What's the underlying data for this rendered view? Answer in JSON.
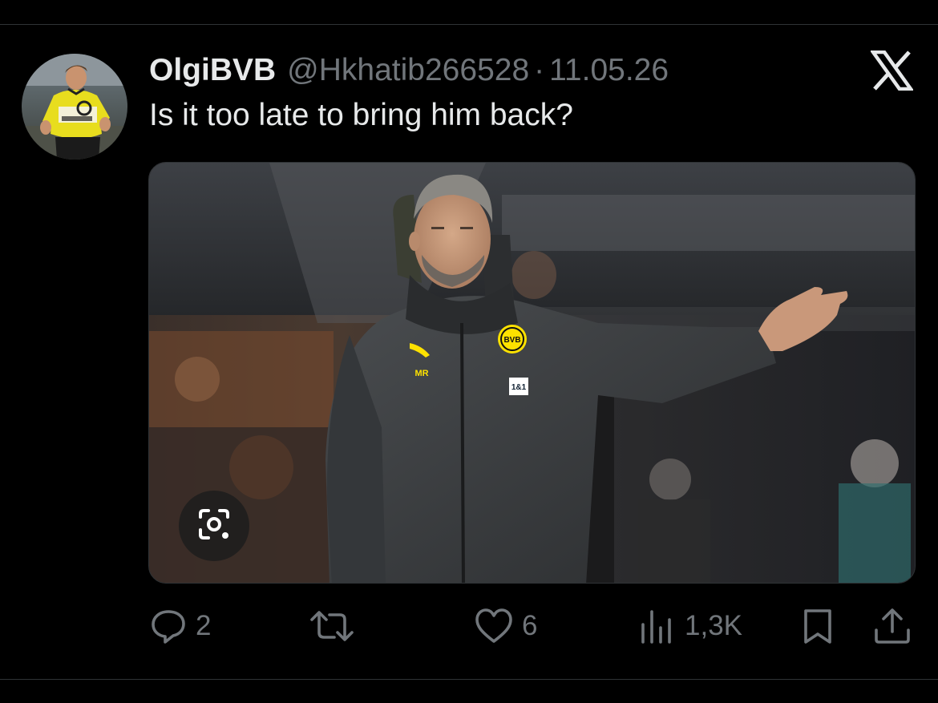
{
  "tweet": {
    "display_name": "OlgiBVB",
    "handle": "@Hkhatib266528",
    "separator": "·",
    "date": "11.05.26",
    "text": "Is it too late to bring him back?"
  },
  "actions": {
    "replies": "2",
    "retweets": "",
    "likes": "6",
    "views": "1,3K"
  },
  "colors": {
    "background": "#000000",
    "text_primary": "#e7e9ea",
    "text_secondary": "#71767b",
    "bvb_yellow": "#fde100",
    "divider": "#2f3336"
  },
  "icons": {
    "brand": "x-logo-icon",
    "media_overlay": "lens-search-icon",
    "reply": "reply-icon",
    "retweet": "retweet-icon",
    "like": "heart-icon",
    "views": "views-chart-icon",
    "bookmark": "bookmark-icon",
    "share": "share-icon"
  }
}
